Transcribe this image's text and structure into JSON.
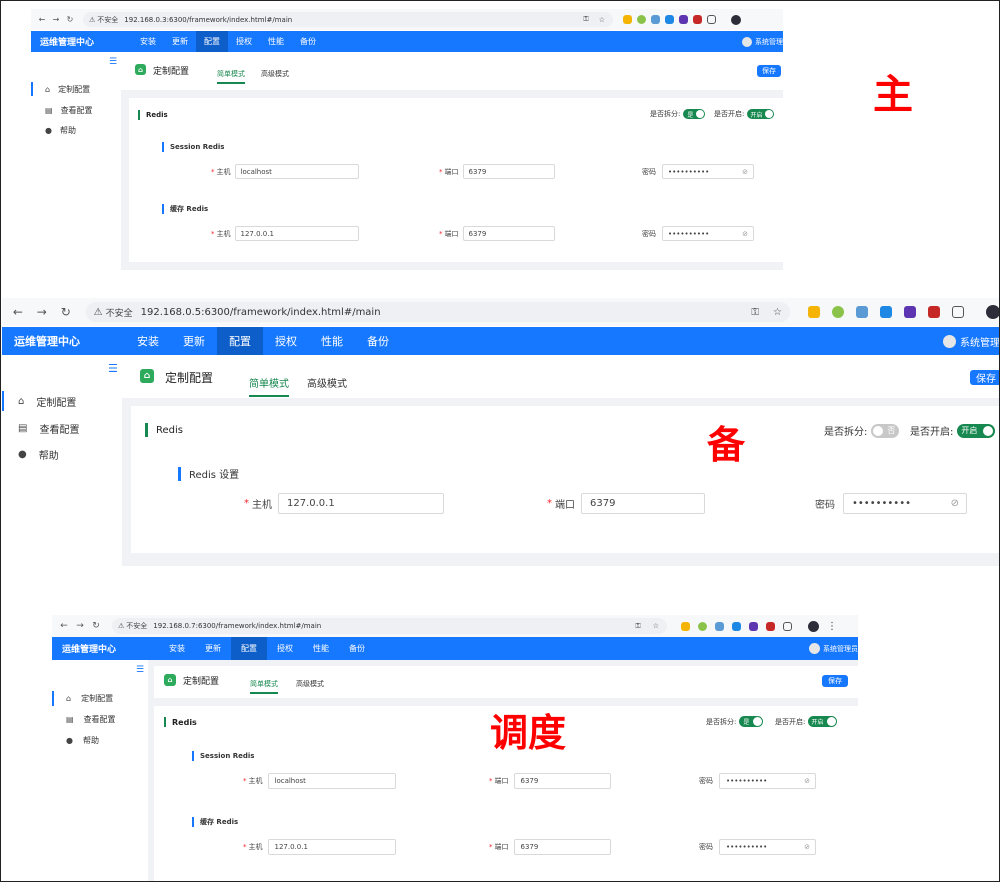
{
  "shots": [
    {
      "url": "192.168.0.3:6300/framework/index.html#/main",
      "insecure_label": "不安全",
      "brand": "运维管理中心",
      "menu": [
        "安装",
        "更新",
        "配置",
        "授权",
        "性能",
        "备份"
      ],
      "active_menu": "配置",
      "user": "系统管理",
      "sidebar": [
        "定制配置",
        "查看配置",
        "帮助"
      ],
      "page_title": "定制配置",
      "tabs": [
        "简单模式",
        "高级模式"
      ],
      "save_label": "保存",
      "section": "Redis",
      "split_label": "是否拆分:",
      "split_value": "是",
      "enable_label": "是否开启:",
      "enable_value": "开启",
      "subsections": [
        {
          "title": "Session Redis",
          "host_label": "主机",
          "host": "localhost",
          "port_label": "端口",
          "port": "6379",
          "pwd_label": "密码",
          "pwd": "••••••••••"
        },
        {
          "title": "缓存 Redis",
          "host_label": "主机",
          "host": "127.0.0.1",
          "port_label": "端口",
          "port": "6379",
          "pwd_label": "密码",
          "pwd": "••••••••••"
        }
      ],
      "mark": "主"
    },
    {
      "url": "192.168.0.5:6300/framework/index.html#/main",
      "insecure_label": "不安全",
      "brand": "运维管理中心",
      "menu": [
        "安装",
        "更新",
        "配置",
        "授权",
        "性能",
        "备份"
      ],
      "active_menu": "配置",
      "user": "系统管理",
      "sidebar": [
        "定制配置",
        "查看配置",
        "帮助"
      ],
      "page_title": "定制配置",
      "tabs": [
        "简单模式",
        "高级模式"
      ],
      "save_label": "保存",
      "section": "Redis",
      "split_label": "是否拆分:",
      "split_value": "否",
      "enable_label": "是否开启:",
      "enable_value": "开启",
      "subsections": [
        {
          "title": "Redis 设置",
          "host_label": "主机",
          "host": "127.0.0.1",
          "port_label": "端口",
          "port": "6379",
          "pwd_label": "密码",
          "pwd": "••••••••••"
        }
      ],
      "mark": "备"
    },
    {
      "url": "192.168.0.7:6300/framework/index.html#/main",
      "insecure_label": "不安全",
      "brand": "运维管理中心",
      "menu": [
        "安装",
        "更新",
        "配置",
        "授权",
        "性能",
        "备份"
      ],
      "active_menu": "配置",
      "user": "系统管理员",
      "sidebar": [
        "定制配置",
        "查看配置",
        "帮助"
      ],
      "page_title": "定制配置",
      "tabs": [
        "简单模式",
        "高级模式"
      ],
      "save_label": "保存",
      "section": "Redis",
      "split_label": "是否拆分:",
      "split_value": "是",
      "enable_label": "是否开启:",
      "enable_value": "开启",
      "subsections": [
        {
          "title": "Session Redis",
          "host_label": "主机",
          "host": "localhost",
          "port_label": "端口",
          "port": "6379",
          "pwd_label": "密码",
          "pwd": "••••••••••"
        },
        {
          "title": "缓存 Redis",
          "host_label": "主机",
          "host": "127.0.0.1",
          "port_label": "端口",
          "port": "6379",
          "pwd_label": "密码",
          "pwd": "••••••••••"
        }
      ],
      "mark": "调度"
    }
  ],
  "colors": {
    "appbar": "#1677ff",
    "active_menu": "#0d5ec9",
    "accent_green": "#17884f",
    "required": "#f5222d",
    "mark": "#ff0000"
  },
  "icons": [
    "back-arrow-icon",
    "forward-arrow-icon",
    "reload-icon",
    "warning-icon",
    "key-icon",
    "star-icon",
    "extension-icon",
    "profile-icon",
    "collapse-menu-icon",
    "home-icon",
    "settings-doc-icon",
    "help-icon",
    "eye-off-icon"
  ]
}
